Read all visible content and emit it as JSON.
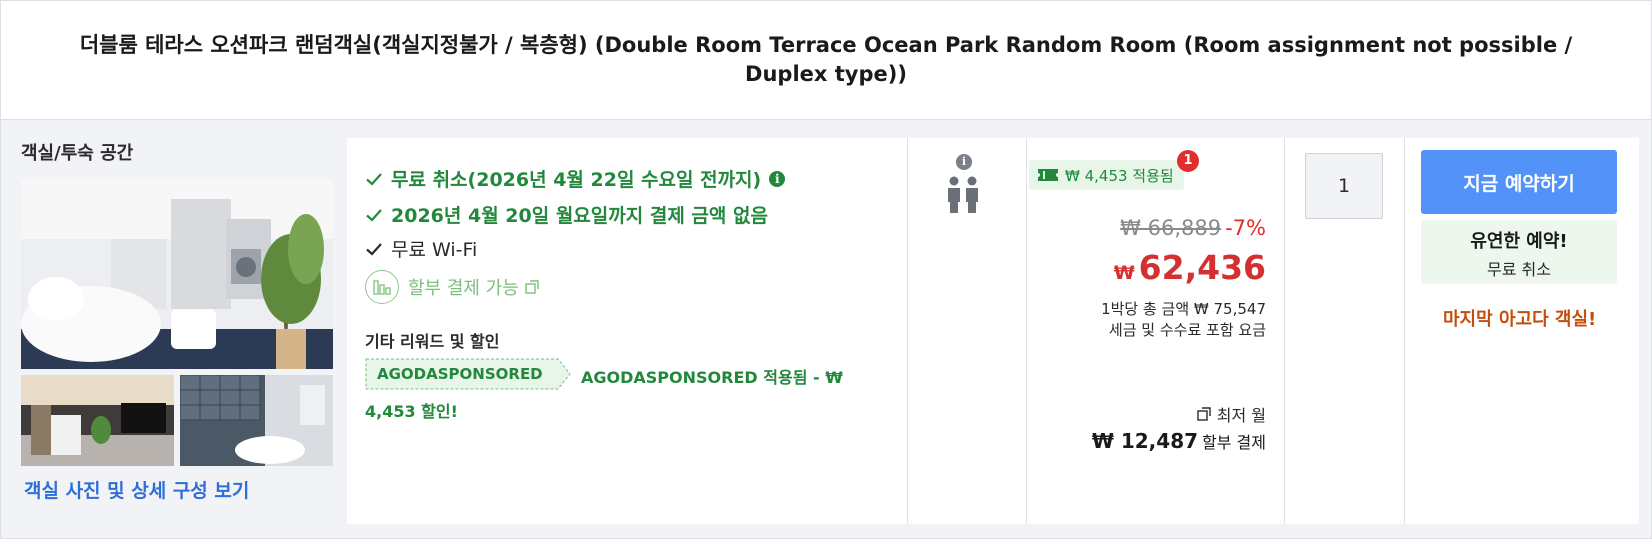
{
  "header": {
    "title": "더블룸 테라스 오션파크 랜덤객실(객실지정불가 / 복층형) (Double Room Terrace Ocean Park Random Room (Room assignment not possible / Duplex type))"
  },
  "room": {
    "type_label": "객실/투숙 공간",
    "photos_link": "객실 사진 및 상세 구성 보기"
  },
  "benefits": {
    "free_cancel": "무료 취소(2026년 4월 22일 수요일 전까지)",
    "pay_later": "2026년 4월 20일 월요일까지 결제 금액 없음",
    "wifi": "무료 Wi-Fi",
    "installment": "할부 결제 가능"
  },
  "rewards": {
    "title": "기타 리워드 및 할인",
    "coupon_code": "AGODASPONSORED",
    "applied_line1": "AGODASPONSORED 적용됨 - ₩",
    "applied_line2": "4,453 할인!"
  },
  "occupancy": {
    "info_icon": "i"
  },
  "price": {
    "discount_badge": "₩ 4,453 적용됨",
    "badge_count": "1",
    "original": "₩ 66,889",
    "discount_pct": "-7%",
    "currency": "₩",
    "current": "62,436",
    "per_night_total": "1박당 총 금액 ₩ 75,547",
    "tax_note": "세금 및 수수료 포함 요금",
    "monthly_label": "최저 월",
    "monthly_value": "₩ 12,487",
    "monthly_suffix": "할부 결제"
  },
  "quantity": {
    "value": "1"
  },
  "booking": {
    "book_button": "지금 예약하기",
    "flex_title": "유연한 예약!",
    "flex_sub": "무료 취소",
    "last_room": "마지막 아고다 객실!"
  },
  "colors": {
    "accent_blue": "#5392f9",
    "green": "#22883b",
    "price_red": "#d3302f",
    "urgency_orange": "#c24e0c"
  }
}
